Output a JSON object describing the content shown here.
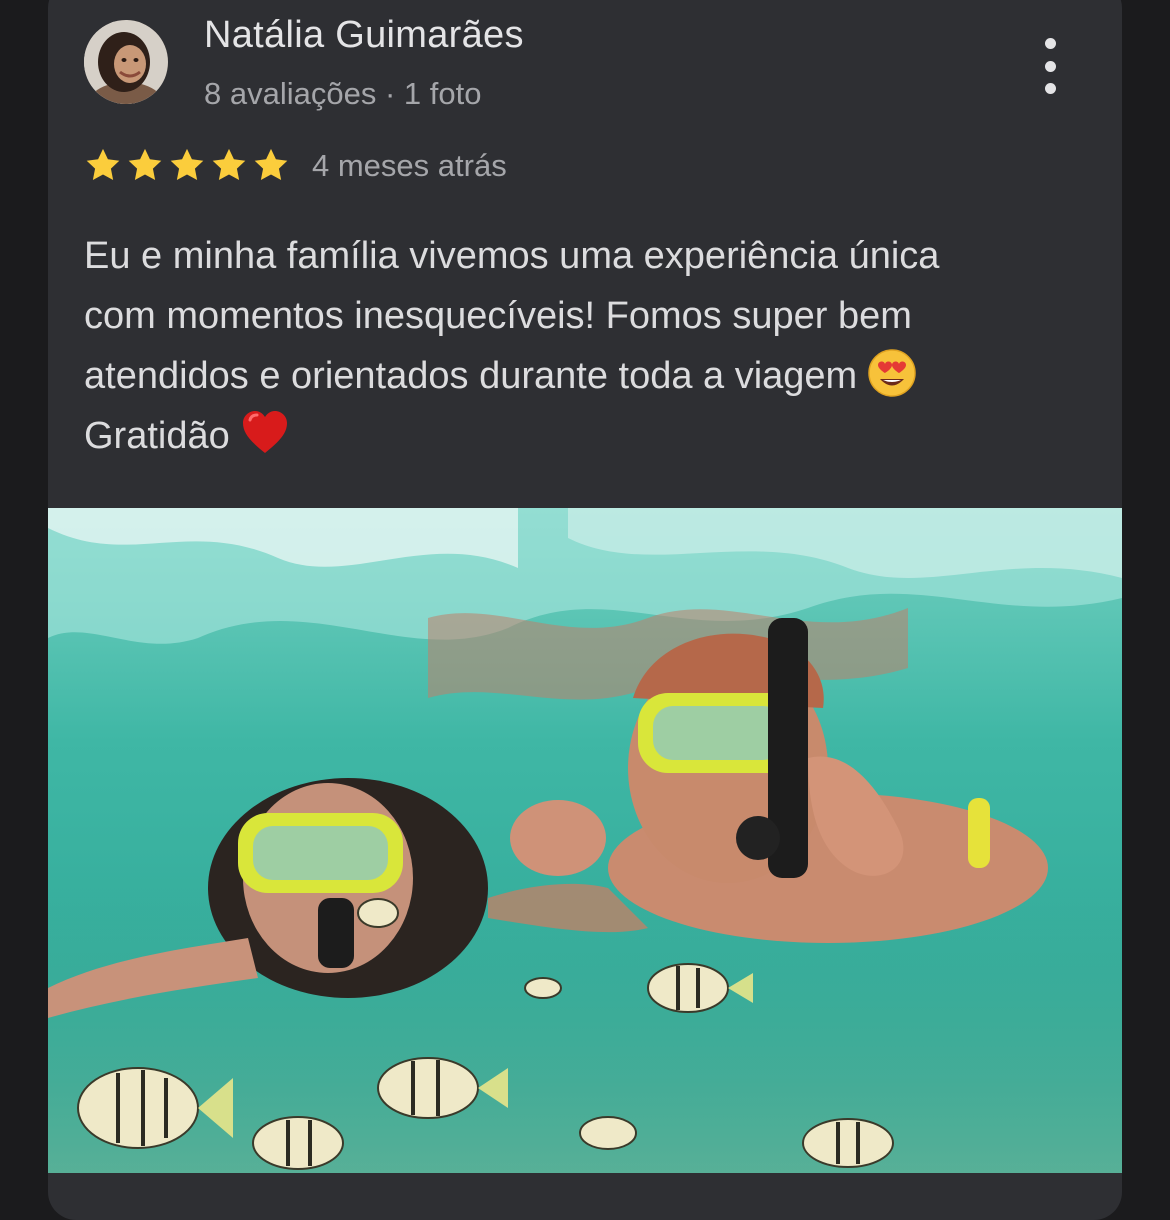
{
  "review": {
    "author_name": "Natália Guimarães",
    "author_meta": "8 avaliações · 1 foto",
    "rating": 5,
    "rating_max": 5,
    "time_ago": "4 meses atrás",
    "text_lines": [
      "Eu e minha família vivemos uma experiência única",
      "com momentos inesquecíveis! Fomos super bem",
      "atendidos e orientados durante toda a viagem",
      "Gratidão"
    ],
    "emojis": [
      "heart-eyes-emoji",
      "red-heart-emoji"
    ],
    "photo": {
      "description_icon": "review-photo"
    }
  },
  "colors": {
    "card_bg": "#2e2f33",
    "page_bg": "#1b1b1d",
    "star": "#fbcd3c",
    "text_primary": "#e4e4e6",
    "text_secondary": "#a5a6aa"
  }
}
